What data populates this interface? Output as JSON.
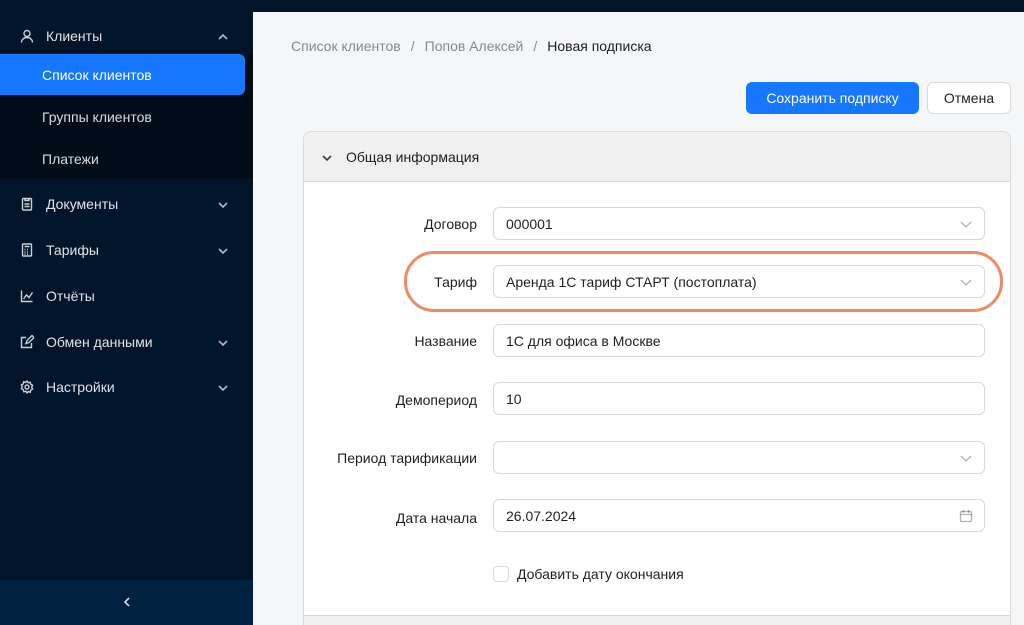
{
  "sidebar": {
    "clients": {
      "label": "Клиенты",
      "icon": "user-icon"
    },
    "submenu": [
      {
        "label": "Список клиентов",
        "active": true
      },
      {
        "label": "Группы клиентов",
        "active": false
      },
      {
        "label": "Платежи",
        "active": false
      }
    ],
    "items": [
      {
        "label": "Документы",
        "icon": "document-icon"
      },
      {
        "label": "Тарифы",
        "icon": "calculator-icon"
      },
      {
        "label": "Отчёты",
        "icon": "line-chart-icon"
      },
      {
        "label": "Обмен данными",
        "icon": "edit-icon"
      },
      {
        "label": "Настройки",
        "icon": "gear-icon"
      }
    ]
  },
  "breadcrumb": {
    "items": [
      "Список клиентов",
      "Попов Алексей",
      "Новая подписка"
    ],
    "separator": "/"
  },
  "actions": {
    "save_label": "Сохранить подписку",
    "cancel_label": "Отмена"
  },
  "section": {
    "title": "Общая информация"
  },
  "form": {
    "contract": {
      "label": "Договор",
      "value": "000001"
    },
    "tariff": {
      "label": "Тариф",
      "value": "Аренда 1С тариф СТАРТ (постоплата)"
    },
    "name": {
      "label": "Название",
      "value": "1С для офиса в Москве"
    },
    "demo": {
      "label": "Демопериод",
      "value": "10"
    },
    "billing_period": {
      "label": "Период тарификации",
      "value": ""
    },
    "start_date": {
      "label": "Дата начала",
      "value": "26.07.2024"
    },
    "end_date_checkbox": {
      "label": "Добавить дату окончания",
      "checked": false
    }
  },
  "colors": {
    "sidebar_bg": "#001529",
    "primary": "#1677ff",
    "highlight": "#ee8a64"
  }
}
